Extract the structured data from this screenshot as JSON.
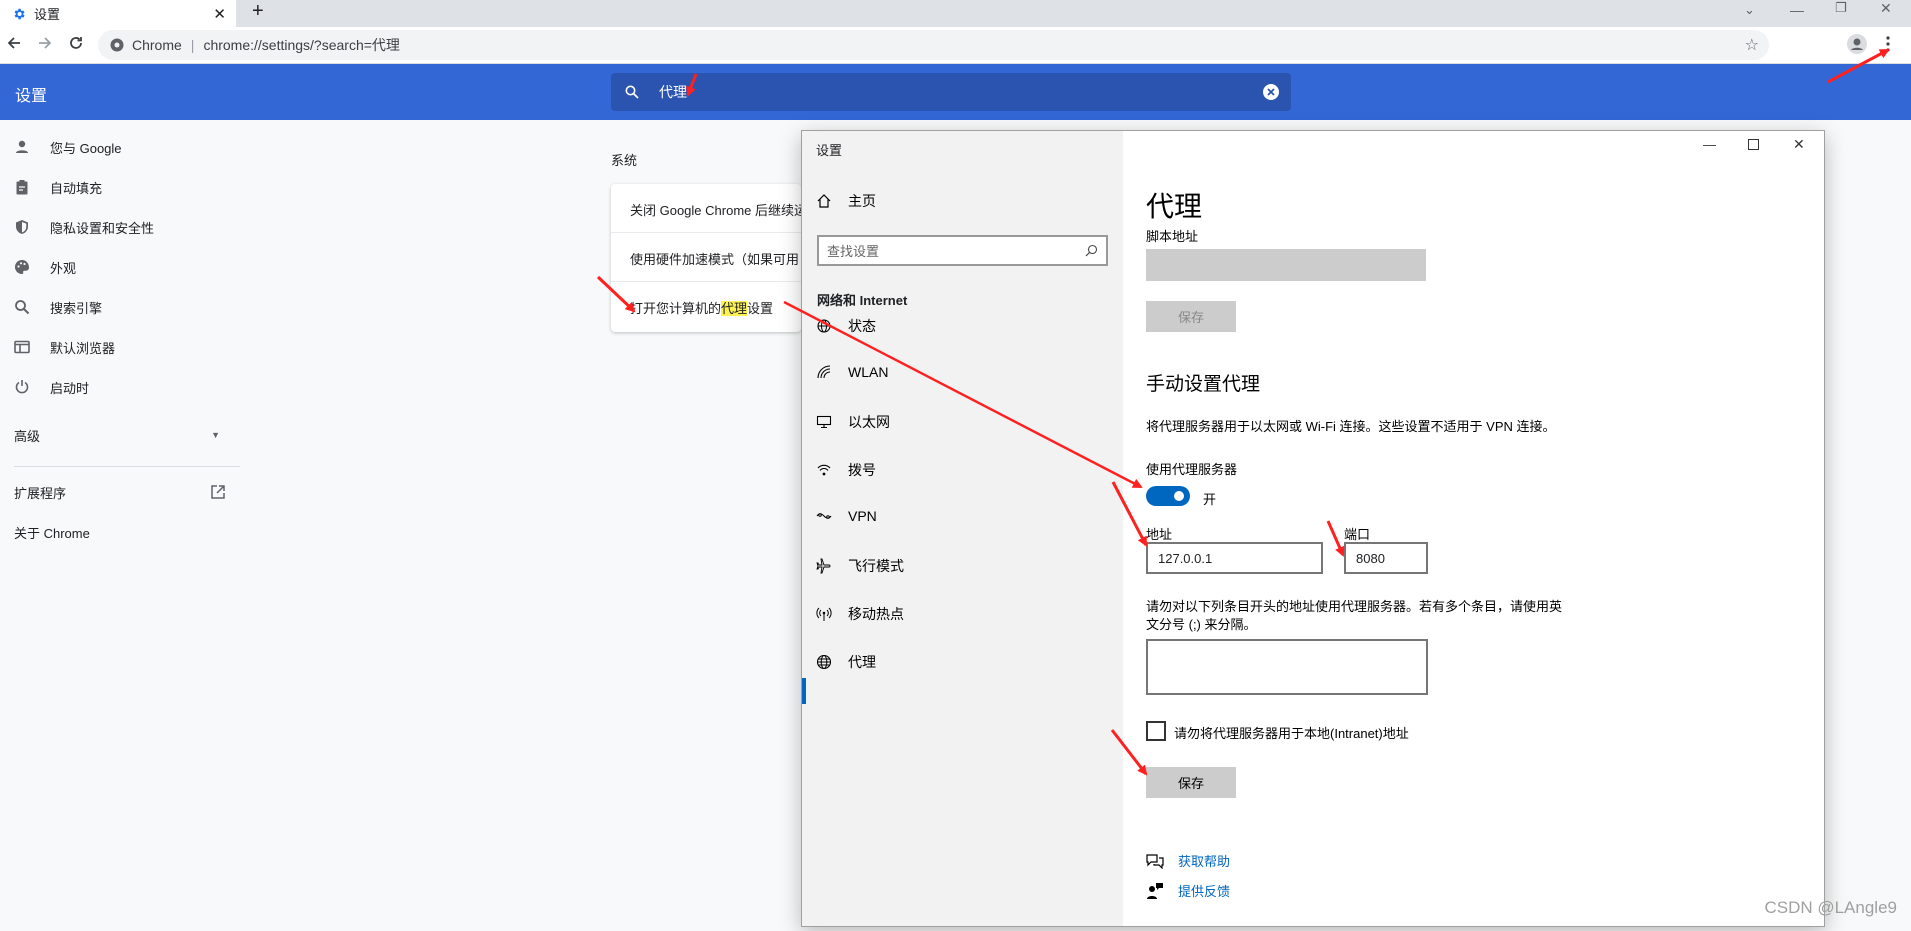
{
  "browser": {
    "tab_title": "设置",
    "new_tab": "+",
    "omnibox_site": "Chrome",
    "omnibox_sep": "|",
    "omnibox_url": "chrome://settings/?search=代理"
  },
  "chrome_settings": {
    "title": "设置",
    "search_value": "代理",
    "nav": [
      {
        "label": "您与 Google",
        "icon": "person-icon"
      },
      {
        "label": "自动填充",
        "icon": "clipboard-icon"
      },
      {
        "label": "隐私设置和安全性",
        "icon": "shield-icon"
      },
      {
        "label": "外观",
        "icon": "palette-icon"
      },
      {
        "label": "搜索引擎",
        "icon": "search-icon"
      },
      {
        "label": "默认浏览器",
        "icon": "browser-icon"
      },
      {
        "label": "启动时",
        "icon": "power-icon"
      }
    ],
    "advanced": "高级",
    "extensions": "扩展程序",
    "about": "关于 Chrome",
    "section_label": "系统",
    "results": [
      "关闭 Google Chrome 后继续运",
      "使用硬件加速模式（如果可用"
    ],
    "proxy_row": {
      "before": "打开您计算机的",
      "highlight": "代理",
      "after": "设置"
    }
  },
  "win_settings": {
    "title": "设置",
    "home": "主页",
    "find_placeholder": "查找设置",
    "category": "网络和 Internet",
    "nav": [
      {
        "label": "状态",
        "icon": "globe-status-icon"
      },
      {
        "label": "WLAN",
        "icon": "wifi-icon"
      },
      {
        "label": "以太网",
        "icon": "ethernet-icon"
      },
      {
        "label": "拨号",
        "icon": "dialup-icon"
      },
      {
        "label": "VPN",
        "icon": "vpn-icon"
      },
      {
        "label": "飞行模式",
        "icon": "airplane-icon"
      },
      {
        "label": "移动热点",
        "icon": "hotspot-icon"
      },
      {
        "label": "代理",
        "icon": "globe-icon",
        "selected": true
      }
    ],
    "page_title": "代理",
    "script_address_label": "脚本地址",
    "script_save": "保存",
    "manual_heading": "手动设置代理",
    "manual_desc": "将代理服务器用于以太网或 Wi-Fi 连接。这些设置不适用于 VPN 连接。",
    "use_proxy_label": "使用代理服务器",
    "toggle_state": "开",
    "toggle_on": true,
    "address_label": "地址",
    "address_value": "127.0.0.1",
    "port_label": "端口",
    "port_value": "8080",
    "exceptions_desc_1": "请勿对以下列条目开头的地址使用代理服务器。若有多个条目，请使用英",
    "exceptions_desc_2": "文分号 (;) 来分隔。",
    "exceptions_value": "",
    "local_checkbox_label": "请勿将代理服务器用于本地(Intranet)地址",
    "local_checked": false,
    "save": "保存",
    "help_link": "获取帮助",
    "feedback_link": "提供反馈"
  },
  "watermark": "CSDN @LAngle9",
  "colors": {
    "chrome_header": "#3367d6",
    "accent": "#0067c0",
    "annotation_arrow": "#ff2020"
  }
}
